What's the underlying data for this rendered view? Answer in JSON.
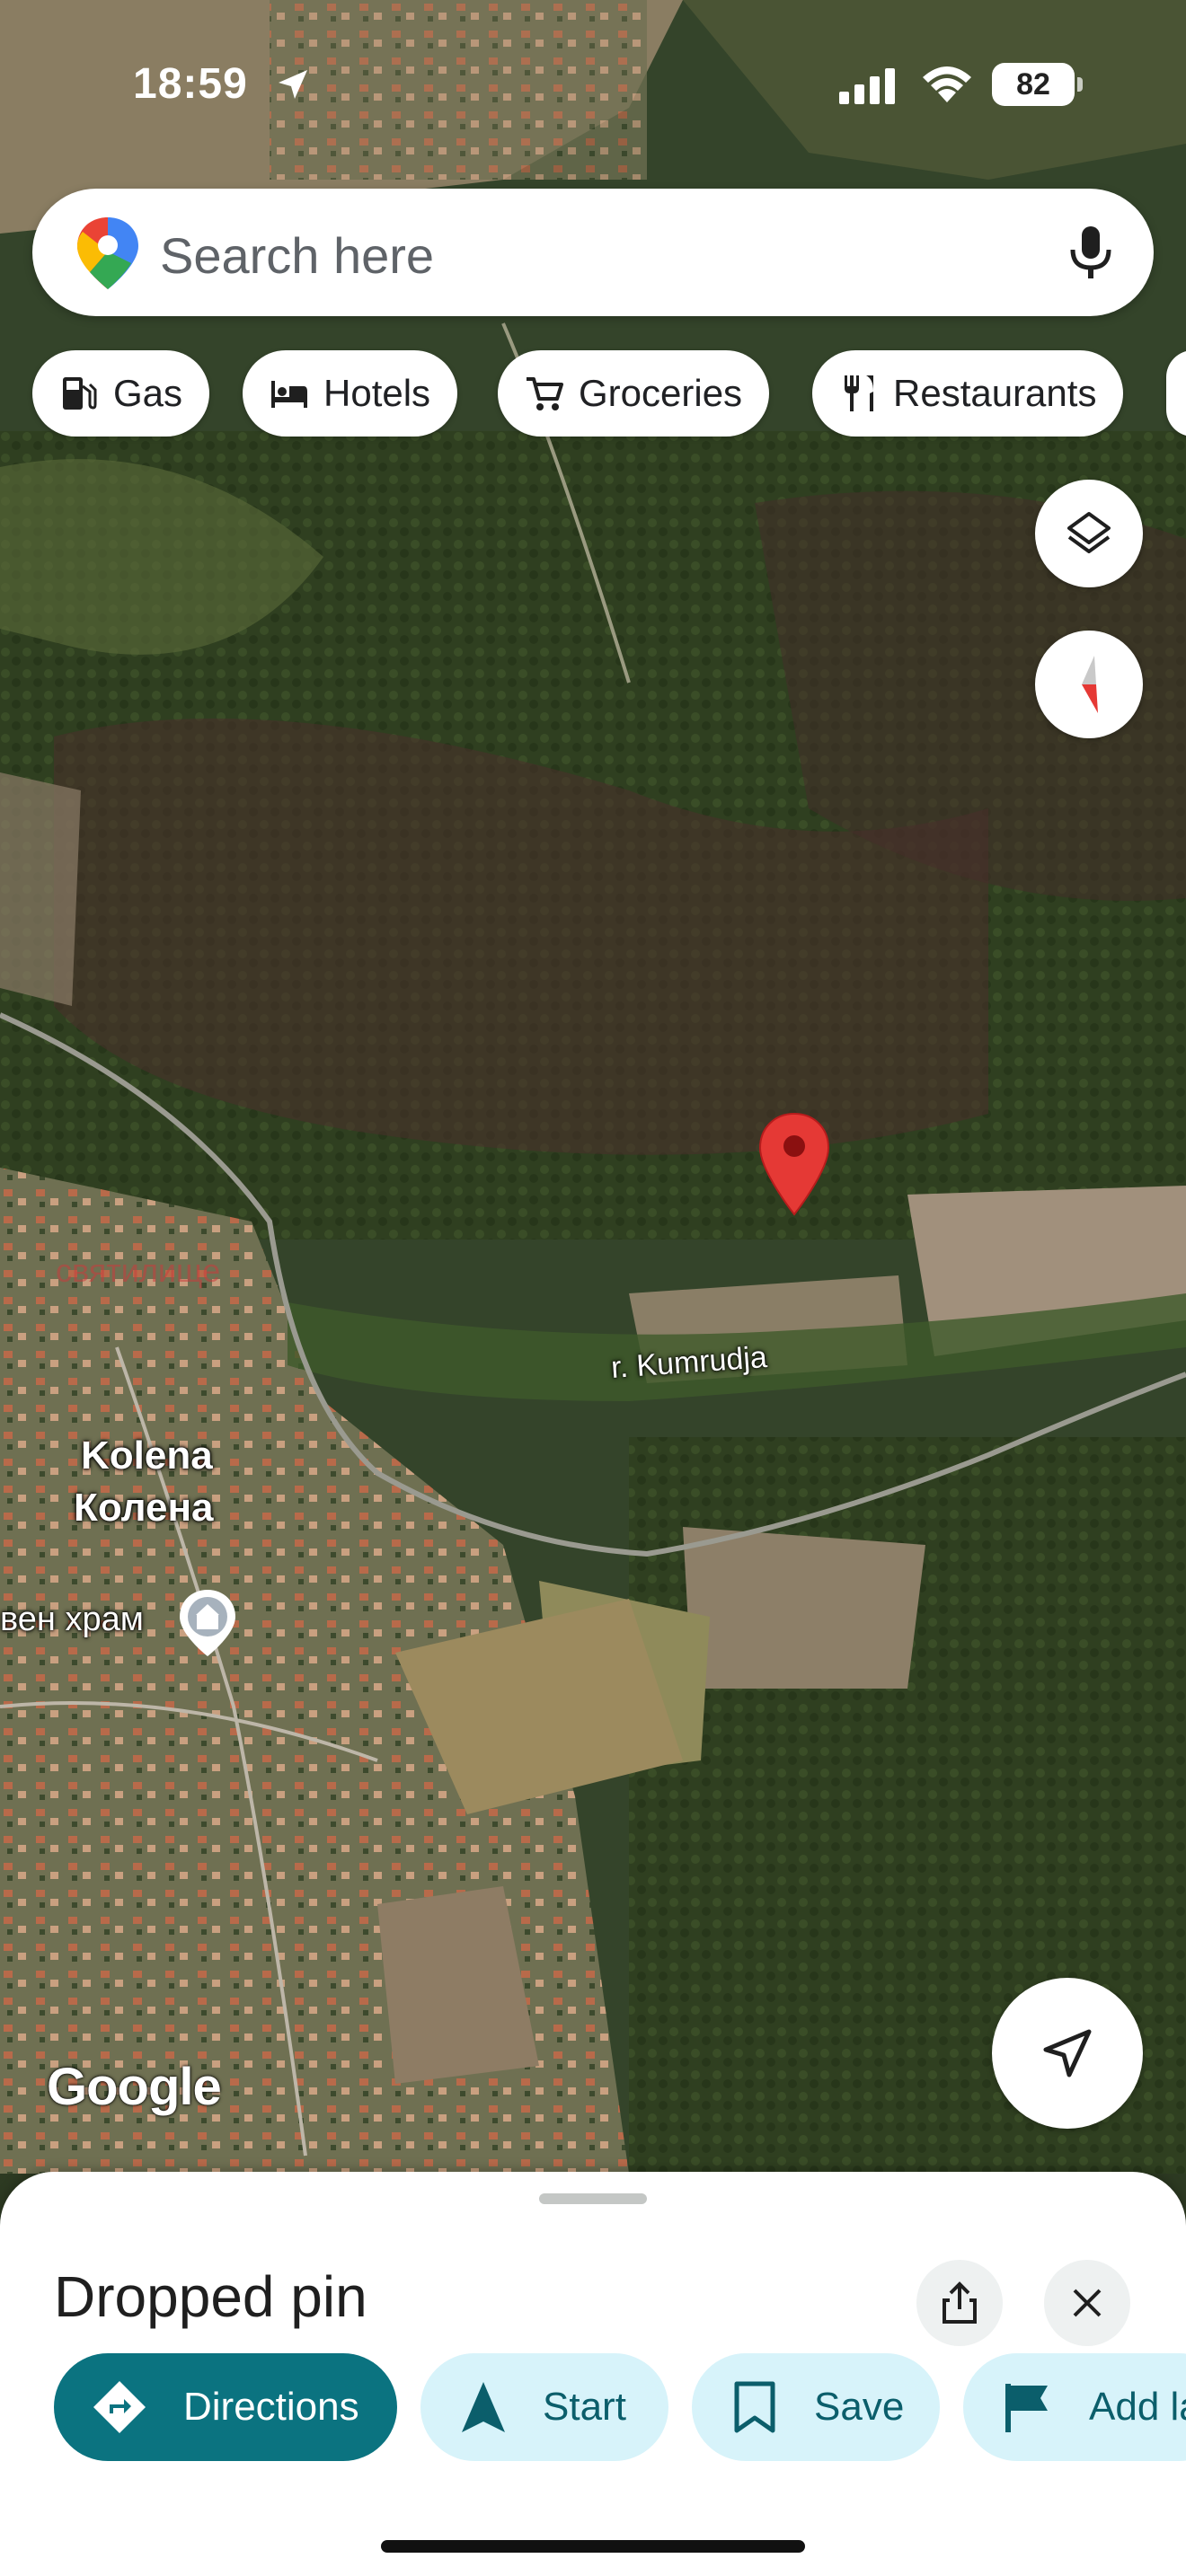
{
  "status_bar": {
    "time": "18:59",
    "battery": "82"
  },
  "search": {
    "placeholder": "Search here"
  },
  "chips": [
    {
      "label": "Gas",
      "icon": "gas-station-icon"
    },
    {
      "label": "Hotels",
      "icon": "bed-icon"
    },
    {
      "label": "Groceries",
      "icon": "cart-icon"
    },
    {
      "label": "Restaurants",
      "icon": "fork-knife-icon"
    }
  ],
  "map": {
    "labels": {
      "river": "r. Kumrudja",
      "town_latin": "Kolena",
      "town_cyrillic": "Колена",
      "church": "вен храм",
      "faint": "святилище"
    },
    "attribution": "Google",
    "pin_color": "#e53935"
  },
  "sheet": {
    "title": "Dropped pin",
    "actions": {
      "directions": "Directions",
      "start": "Start",
      "save": "Save",
      "add_label": "Add la"
    }
  },
  "colors": {
    "accent": "#0b7380",
    "tonal": "#d7f3fa"
  }
}
